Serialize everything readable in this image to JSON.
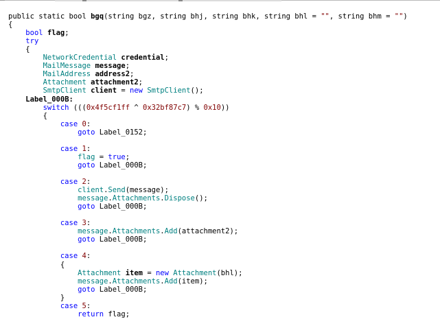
{
  "window": {
    "accent_keyword": "#0000ff",
    "accent_type": "#008080",
    "text_color": "#000000"
  },
  "code": {
    "lines": [
      {
        "indent": "",
        "tokens": [
          {
            "t": "public static bool ",
            "c": "id"
          },
          {
            "t": "bgq",
            "c": "bold"
          },
          {
            "t": "(",
            "c": "id"
          },
          {
            "t": "string",
            "c": "id"
          },
          {
            "t": " bgz, ",
            "c": "id"
          },
          {
            "t": "string",
            "c": "id"
          },
          {
            "t": " bhj, ",
            "c": "id"
          },
          {
            "t": "string",
            "c": "id"
          },
          {
            "t": " bhk, ",
            "c": "id"
          },
          {
            "t": "string",
            "c": "id"
          },
          {
            "t": " bhl = ",
            "c": "id"
          },
          {
            "t": "\"\"",
            "c": "str"
          },
          {
            "t": ", ",
            "c": "id"
          },
          {
            "t": "string",
            "c": "id"
          },
          {
            "t": " bhm = ",
            "c": "id"
          },
          {
            "t": "\"\"",
            "c": "str"
          },
          {
            "t": ")",
            "c": "id"
          }
        ]
      },
      {
        "indent": "",
        "tokens": [
          {
            "t": "{",
            "c": "id"
          }
        ]
      },
      {
        "indent": "    ",
        "tokens": [
          {
            "t": "bool",
            "c": "kw"
          },
          {
            "t": " ",
            "c": "id"
          },
          {
            "t": "flag",
            "c": "bold"
          },
          {
            "t": ";",
            "c": "id"
          }
        ]
      },
      {
        "indent": "    ",
        "tokens": [
          {
            "t": "try",
            "c": "kw"
          }
        ]
      },
      {
        "indent": "    ",
        "tokens": [
          {
            "t": "{",
            "c": "id"
          }
        ]
      },
      {
        "indent": "        ",
        "tokens": [
          {
            "t": "NetworkCredential",
            "c": "ty"
          },
          {
            "t": " ",
            "c": "id"
          },
          {
            "t": "credential",
            "c": "bold"
          },
          {
            "t": ";",
            "c": "id"
          }
        ]
      },
      {
        "indent": "        ",
        "tokens": [
          {
            "t": "MailMessage",
            "c": "ty"
          },
          {
            "t": " ",
            "c": "id"
          },
          {
            "t": "message",
            "c": "bold"
          },
          {
            "t": ";",
            "c": "id"
          }
        ]
      },
      {
        "indent": "        ",
        "tokens": [
          {
            "t": "MailAddress",
            "c": "ty"
          },
          {
            "t": " ",
            "c": "id"
          },
          {
            "t": "address2",
            "c": "bold"
          },
          {
            "t": ";",
            "c": "id"
          }
        ]
      },
      {
        "indent": "        ",
        "tokens": [
          {
            "t": "Attachment",
            "c": "ty"
          },
          {
            "t": " ",
            "c": "id"
          },
          {
            "t": "attachment2",
            "c": "bold"
          },
          {
            "t": ";",
            "c": "id"
          }
        ]
      },
      {
        "indent": "        ",
        "tokens": [
          {
            "t": "SmtpClient",
            "c": "ty"
          },
          {
            "t": " ",
            "c": "id"
          },
          {
            "t": "client",
            "c": "bold"
          },
          {
            "t": " = ",
            "c": "id"
          },
          {
            "t": "new",
            "c": "kw"
          },
          {
            "t": " ",
            "c": "id"
          },
          {
            "t": "SmtpClient",
            "c": "ty"
          },
          {
            "t": "();",
            "c": "id"
          }
        ]
      },
      {
        "indent": "    ",
        "tokens": [
          {
            "t": "Label_000B:",
            "c": "bold"
          }
        ]
      },
      {
        "indent": "        ",
        "tokens": [
          {
            "t": "switch",
            "c": "kw"
          },
          {
            "t": " (((",
            "c": "id"
          },
          {
            "t": "0x4f5cf1ff",
            "c": "str"
          },
          {
            "t": " ^ ",
            "c": "id"
          },
          {
            "t": "0x32bf87c7",
            "c": "str"
          },
          {
            "t": ") % ",
            "c": "id"
          },
          {
            "t": "0x10",
            "c": "str"
          },
          {
            "t": "))",
            "c": "id"
          }
        ]
      },
      {
        "indent": "        ",
        "tokens": [
          {
            "t": "{",
            "c": "id"
          }
        ]
      },
      {
        "indent": "            ",
        "tokens": [
          {
            "t": "case",
            "c": "kw"
          },
          {
            "t": " ",
            "c": "id"
          },
          {
            "t": "0",
            "c": "str"
          },
          {
            "t": ":",
            "c": "id"
          }
        ]
      },
      {
        "indent": "                ",
        "tokens": [
          {
            "t": "goto",
            "c": "kw"
          },
          {
            "t": " Label_0152;",
            "c": "id"
          }
        ]
      },
      {
        "indent": "",
        "tokens": []
      },
      {
        "indent": "            ",
        "tokens": [
          {
            "t": "case",
            "c": "kw"
          },
          {
            "t": " ",
            "c": "id"
          },
          {
            "t": "1",
            "c": "str"
          },
          {
            "t": ":",
            "c": "id"
          }
        ]
      },
      {
        "indent": "                ",
        "tokens": [
          {
            "t": "flag",
            "c": "ty"
          },
          {
            "t": " = ",
            "c": "id"
          },
          {
            "t": "true",
            "c": "kw"
          },
          {
            "t": ";",
            "c": "id"
          }
        ]
      },
      {
        "indent": "                ",
        "tokens": [
          {
            "t": "goto",
            "c": "kw"
          },
          {
            "t": " Label_000B;",
            "c": "id"
          }
        ]
      },
      {
        "indent": "",
        "tokens": []
      },
      {
        "indent": "            ",
        "tokens": [
          {
            "t": "case",
            "c": "kw"
          },
          {
            "t": " ",
            "c": "id"
          },
          {
            "t": "2",
            "c": "str"
          },
          {
            "t": ":",
            "c": "id"
          }
        ]
      },
      {
        "indent": "                ",
        "tokens": [
          {
            "t": "client",
            "c": "ty"
          },
          {
            "t": ".",
            "c": "id"
          },
          {
            "t": "Send",
            "c": "ty"
          },
          {
            "t": "(message);",
            "c": "id"
          }
        ]
      },
      {
        "indent": "                ",
        "tokens": [
          {
            "t": "message",
            "c": "ty"
          },
          {
            "t": ".",
            "c": "id"
          },
          {
            "t": "Attachments",
            "c": "ty"
          },
          {
            "t": ".",
            "c": "id"
          },
          {
            "t": "Dispose",
            "c": "ty"
          },
          {
            "t": "();",
            "c": "id"
          }
        ]
      },
      {
        "indent": "                ",
        "tokens": [
          {
            "t": "goto",
            "c": "kw"
          },
          {
            "t": " Label_000B;",
            "c": "id"
          }
        ]
      },
      {
        "indent": "",
        "tokens": []
      },
      {
        "indent": "            ",
        "tokens": [
          {
            "t": "case",
            "c": "kw"
          },
          {
            "t": " ",
            "c": "id"
          },
          {
            "t": "3",
            "c": "str"
          },
          {
            "t": ":",
            "c": "id"
          }
        ]
      },
      {
        "indent": "                ",
        "tokens": [
          {
            "t": "message",
            "c": "ty"
          },
          {
            "t": ".",
            "c": "id"
          },
          {
            "t": "Attachments",
            "c": "ty"
          },
          {
            "t": ".",
            "c": "id"
          },
          {
            "t": "Add",
            "c": "ty"
          },
          {
            "t": "(attachment2);",
            "c": "id"
          }
        ]
      },
      {
        "indent": "                ",
        "tokens": [
          {
            "t": "goto",
            "c": "kw"
          },
          {
            "t": " Label_000B;",
            "c": "id"
          }
        ]
      },
      {
        "indent": "",
        "tokens": []
      },
      {
        "indent": "            ",
        "tokens": [
          {
            "t": "case",
            "c": "kw"
          },
          {
            "t": " ",
            "c": "id"
          },
          {
            "t": "4",
            "c": "str"
          },
          {
            "t": ":",
            "c": "id"
          }
        ]
      },
      {
        "indent": "            ",
        "tokens": [
          {
            "t": "{",
            "c": "id"
          }
        ]
      },
      {
        "indent": "                ",
        "tokens": [
          {
            "t": "Attachment",
            "c": "ty"
          },
          {
            "t": " ",
            "c": "id"
          },
          {
            "t": "item",
            "c": "bold"
          },
          {
            "t": " = ",
            "c": "id"
          },
          {
            "t": "new",
            "c": "kw"
          },
          {
            "t": " ",
            "c": "id"
          },
          {
            "t": "Attachment",
            "c": "ty"
          },
          {
            "t": "(bhl);",
            "c": "id"
          }
        ]
      },
      {
        "indent": "                ",
        "tokens": [
          {
            "t": "message",
            "c": "ty"
          },
          {
            "t": ".",
            "c": "id"
          },
          {
            "t": "Attachments",
            "c": "ty"
          },
          {
            "t": ".",
            "c": "id"
          },
          {
            "t": "Add",
            "c": "ty"
          },
          {
            "t": "(item);",
            "c": "id"
          }
        ]
      },
      {
        "indent": "                ",
        "tokens": [
          {
            "t": "goto",
            "c": "kw"
          },
          {
            "t": " Label_000B;",
            "c": "id"
          }
        ]
      },
      {
        "indent": "            ",
        "tokens": [
          {
            "t": "}",
            "c": "id"
          }
        ]
      },
      {
        "indent": "            ",
        "tokens": [
          {
            "t": "case",
            "c": "kw"
          },
          {
            "t": " ",
            "c": "id"
          },
          {
            "t": "5",
            "c": "str"
          },
          {
            "t": ":",
            "c": "id"
          }
        ]
      },
      {
        "indent": "                ",
        "tokens": [
          {
            "t": "return",
            "c": "kw"
          },
          {
            "t": " flag;",
            "c": "id"
          }
        ]
      }
    ]
  }
}
